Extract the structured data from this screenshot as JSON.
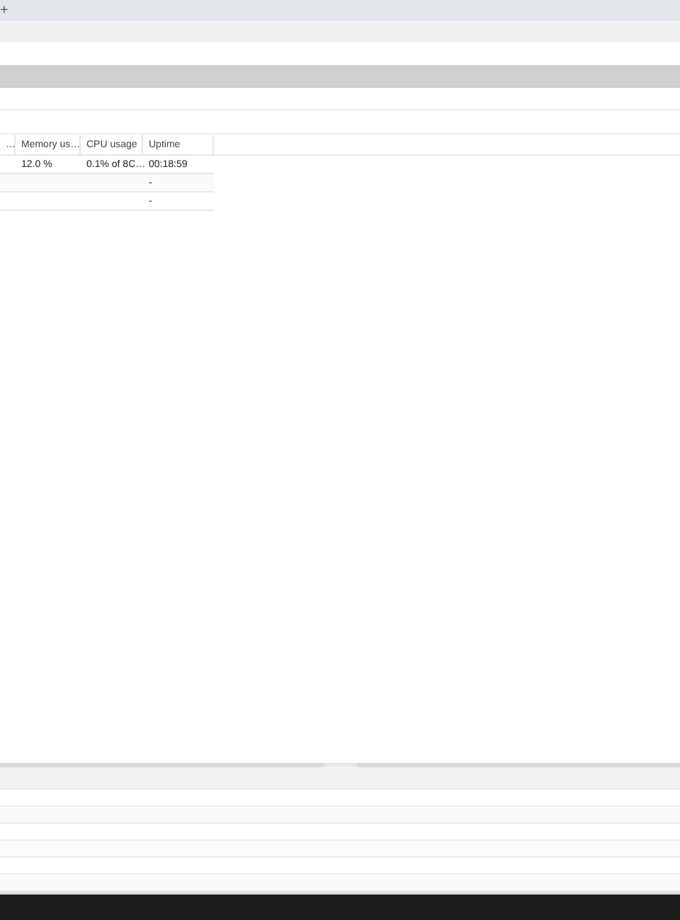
{
  "tab_bar": {
    "new_tab_label": "+"
  },
  "table": {
    "columns": [
      "…",
      "Memory us…",
      "CPU usage",
      "Uptime"
    ],
    "rows": [
      {
        "cells": [
          null,
          "12.0 %",
          "0.1% of 8C…",
          "00:18:59"
        ]
      },
      {
        "cells": [
          null,
          null,
          null,
          "-"
        ]
      },
      {
        "cells": [
          null,
          null,
          null,
          "-"
        ]
      }
    ]
  }
}
